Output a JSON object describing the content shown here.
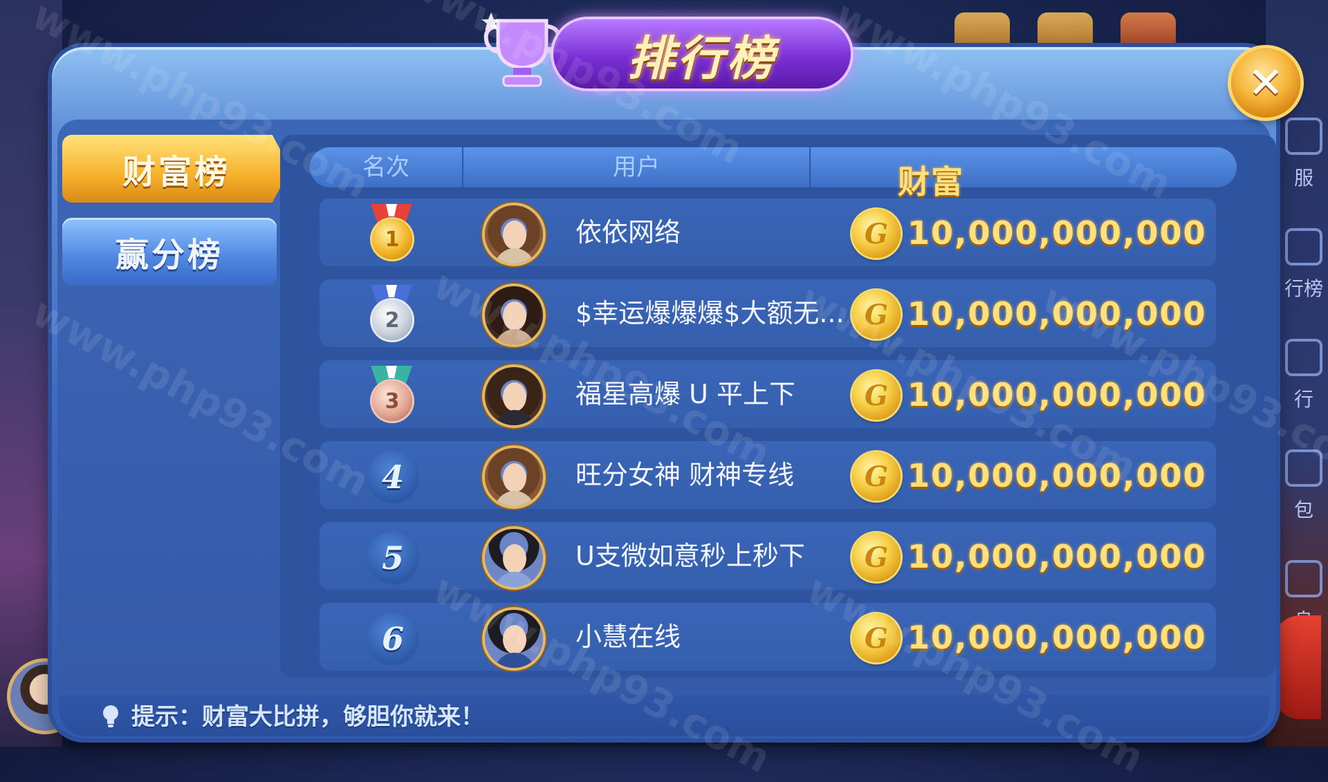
{
  "title": "排行榜",
  "close_icon": "✕",
  "tabs": [
    {
      "label": "财富榜",
      "active": true
    },
    {
      "label": "赢分榜",
      "active": false
    }
  ],
  "columns": {
    "rank": "名次",
    "user": "用户",
    "wealth": "财富"
  },
  "rows": [
    {
      "rank": "1",
      "rank_style": "gold-medal",
      "name": "依依网络",
      "wealth": "10,000,000,000"
    },
    {
      "rank": "2",
      "rank_style": "silver-medal",
      "name": "$幸运爆爆爆$大额无...",
      "wealth": "10,000,000,000"
    },
    {
      "rank": "3",
      "rank_style": "bronze-medal",
      "name": "福星高爆 U 平上下",
      "wealth": "10,000,000,000"
    },
    {
      "rank": "4",
      "rank_style": "number-badge",
      "name": "旺分女神 财神专线",
      "wealth": "10,000,000,000"
    },
    {
      "rank": "5",
      "rank_style": "number-badge",
      "name": "U支微如意秒上秒下",
      "wealth": "10,000,000,000"
    },
    {
      "rank": "6",
      "rank_style": "number-badge",
      "name": "小慧在线",
      "wealth": "10,000,000,000"
    }
  ],
  "coin_glyph": "G",
  "tip": {
    "text": "提示：财富大比拼，够胆你就来！"
  },
  "side_menu": [
    "服",
    "行榜",
    "行",
    "包",
    "息"
  ],
  "watermark": "www.php93.com",
  "colors": {
    "accent_gold": "#f6b12c",
    "title_purple": "#7a2fd6",
    "panel_blue": "#3e6cc2",
    "wealth_text": "#ffe07a"
  }
}
